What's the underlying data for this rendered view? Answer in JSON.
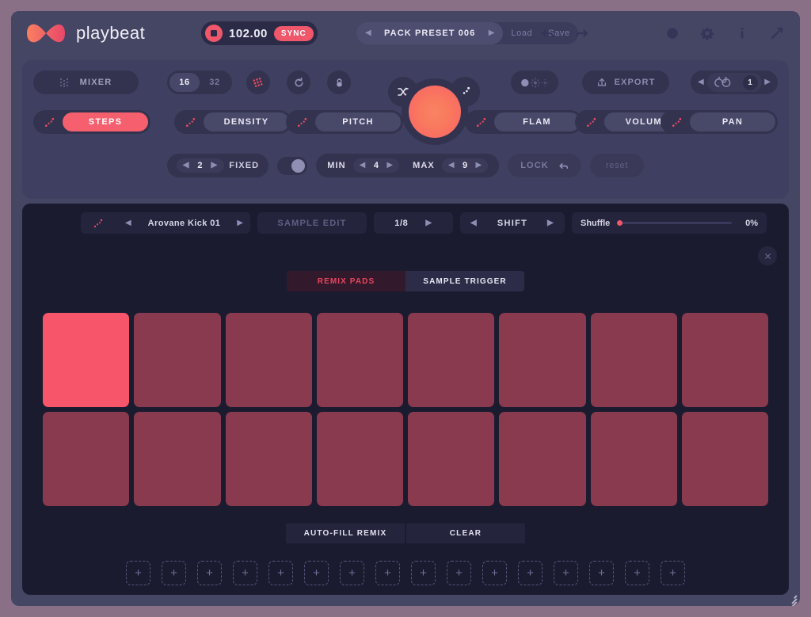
{
  "app": {
    "name": "playbeat"
  },
  "header": {
    "transport": {
      "bpm": "102.00",
      "sync_label": "SYNC",
      "stop_icon": "stop-icon"
    },
    "preset": {
      "name": "PACK PRESET 006",
      "prev_icon": "chevron-left-icon",
      "next_icon": "chevron-right-icon",
      "load_label": "Load",
      "save_label": "Save"
    },
    "icons": [
      "undo-icon",
      "redo-icon",
      "globe-icon",
      "gear-icon",
      "info-icon",
      "expand-icon"
    ]
  },
  "top_panel": {
    "mixer_label": "MIXER",
    "mixer_icon": "mixer-grid-icon",
    "steps_segment": {
      "options": [
        "16",
        "32"
      ],
      "selected": "16"
    },
    "circle_buttons": [
      "pattern-grid-icon",
      "undo-circle-icon",
      "lock-circle-icon"
    ],
    "knob": {
      "left_lobe_icon": "shuffle-icon",
      "right_lobe_icon": "randomize-dots-icon",
      "main_color": "#f96e62"
    },
    "dither_icon": "dither-icon",
    "export_label": "EXPORT",
    "export_icon": "export-icon",
    "loop": {
      "icon": "infinity-icon",
      "count": "1",
      "prev_icon": "chevron-left-icon",
      "next_icon": "chevron-right-icon"
    },
    "params": [
      {
        "label": "STEPS",
        "active": true
      },
      {
        "label": "DENSITY",
        "active": false
      },
      {
        "label": "PITCH",
        "active": false
      },
      {
        "label": "FLAM",
        "active": false
      },
      {
        "label": "VOLUME",
        "active": false
      },
      {
        "label": "PAN",
        "active": false
      }
    ],
    "fixed": {
      "value": "2",
      "label": "FIXED"
    },
    "range": {
      "min_label": "MIN",
      "min_value": "4",
      "max_label": "MAX",
      "max_value": "9"
    },
    "lock_label": "LOCK",
    "lock_icon": "undo-arrow-icon",
    "reset_label": "reset"
  },
  "sample_strip": {
    "dots_icon": "randomize-dots-icon",
    "sample_name": "Arovane Kick 01",
    "sample_edit_label": "SAMPLE EDIT",
    "rate_value": "1/8",
    "shift_label": "SHIFT",
    "shuffle_label": "Shuffle",
    "shuffle_value": "0%"
  },
  "close_icon": "close-icon",
  "tabs": [
    {
      "label": "REMIX PADS",
      "selected": true
    },
    {
      "label": "SAMPLE TRIGGER",
      "selected": false
    }
  ],
  "pads": {
    "columns": 8,
    "rows": 2,
    "lit_color": "#f7556a",
    "unlit_color": "#893a4e",
    "cells": [
      {
        "lit": true
      },
      {
        "lit": false
      },
      {
        "lit": false
      },
      {
        "lit": false
      },
      {
        "lit": false
      },
      {
        "lit": false
      },
      {
        "lit": false
      },
      {
        "lit": false
      },
      {
        "lit": false
      },
      {
        "lit": false
      },
      {
        "lit": false
      },
      {
        "lit": false
      },
      {
        "lit": false
      },
      {
        "lit": false
      },
      {
        "lit": false
      },
      {
        "lit": false
      }
    ]
  },
  "actions": [
    {
      "label": "AUTO-FILL REMIX"
    },
    {
      "label": "CLEAR"
    }
  ],
  "slots": {
    "count": 16,
    "add_icon": "plus-icon",
    "items": [
      "+",
      "+",
      "+",
      "+",
      "+",
      "+",
      "+",
      "+",
      "+",
      "+",
      "+",
      "+",
      "+",
      "+",
      "+",
      "+"
    ]
  },
  "colors": {
    "desktop": "#8a7087",
    "window": "#454564",
    "panel": "#3f3f61",
    "control": "#33334f",
    "body_dark": "#1b1b30",
    "accent": "#f55f6e",
    "tab_selected_text": "#e8465e"
  }
}
